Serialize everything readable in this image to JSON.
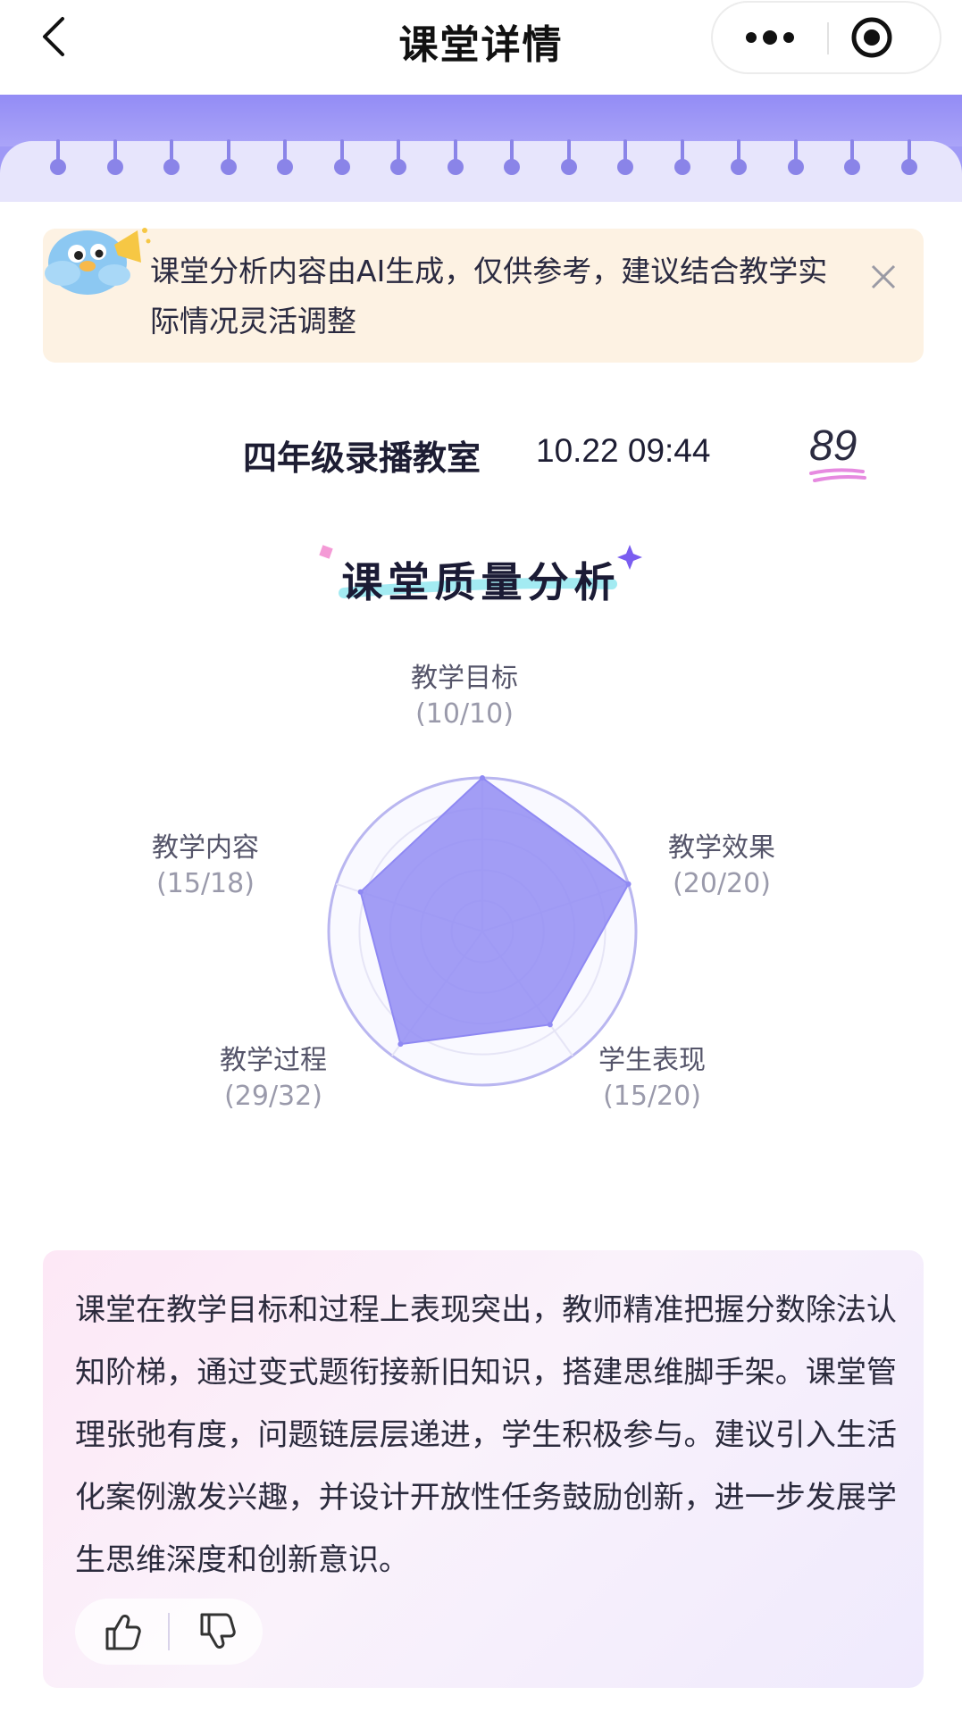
{
  "header": {
    "title": "课堂详情",
    "back_icon": "chevron-left-icon",
    "more_icon": "more-dots-icon",
    "target_icon": "target-icon"
  },
  "notice": {
    "text": "课堂分析内容由AI生成，仅供参考，建议结合教学实际情况灵活调整",
    "mascot_icon": "bird-megaphone-mascot",
    "close_icon": "close-icon"
  },
  "meta": {
    "room": "四年级录播教室",
    "time": "10.22 09:44",
    "score": "89"
  },
  "section": {
    "title": "课堂质量分析"
  },
  "chart_data": {
    "type": "radar",
    "axes": [
      {
        "label": "教学目标",
        "score_text": "(10/10)",
        "score": 10,
        "max": 10
      },
      {
        "label": "教学效果",
        "score_text": "(20/20)",
        "score": 20,
        "max": 20
      },
      {
        "label": "学生表现",
        "score_text": "(15/20)",
        "score": 15,
        "max": 20
      },
      {
        "label": "教学过程",
        "score_text": "(29/32)",
        "score": 29,
        "max": 32
      },
      {
        "label": "教学内容",
        "score_text": "(15/18)",
        "score": 15,
        "max": 18
      }
    ],
    "fill_color": "#8f89f3",
    "ring_color": "#b9b6f0"
  },
  "summary": {
    "text": "课堂在教学目标和过程上表现突出，教师精准把握分数除法认知阶梯，通过变式题衔接新旧知识，搭建思维脚手架。课堂管理张弛有度，问题链层层递进，学生积极参与。建议引入生活化案例激发兴趣，并设计开放性任务鼓励创新，进一步发展学生思维深度和创新意识。",
    "like_icon": "thumbs-up-icon",
    "dislike_icon": "thumbs-down-icon"
  },
  "colors": {
    "accent": "#9f99f6",
    "notice_bg": "#fdf2e3"
  }
}
